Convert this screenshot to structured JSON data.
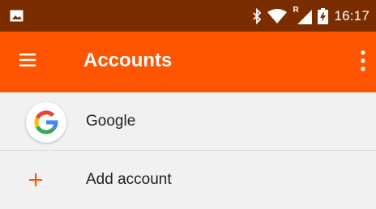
{
  "status_bar": {
    "time": "16:17",
    "icons": [
      "image-icon",
      "bluetooth-icon",
      "wifi-icon",
      "cellular-roaming-icon",
      "battery-charging-icon"
    ],
    "roaming_indicator": "R"
  },
  "app_bar": {
    "title": "Accounts",
    "background": "#ff5400"
  },
  "accounts": [
    {
      "label": "Google",
      "icon": "google-logo-icon"
    }
  ],
  "add_account": {
    "label": "Add account",
    "icon": "plus-icon",
    "icon_color": "#ff5400"
  }
}
